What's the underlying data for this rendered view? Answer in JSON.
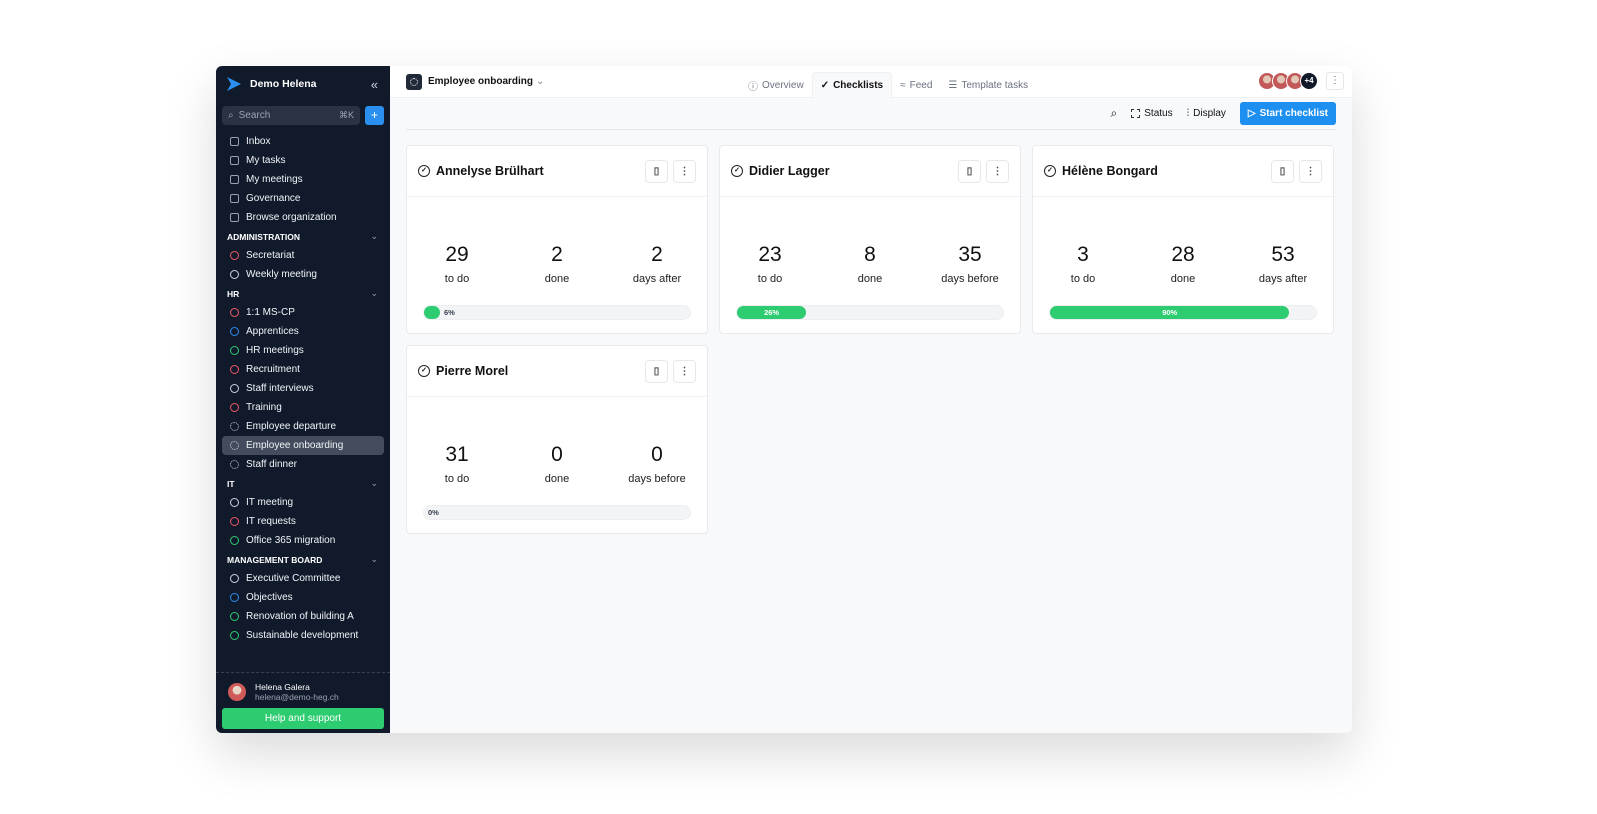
{
  "sidebar": {
    "org": "Demo Helena",
    "search_placeholder": "Search",
    "search_shortcut": "⌘K",
    "nav": [
      {
        "label": "Inbox",
        "icon": "inbox-icon"
      },
      {
        "label": "My tasks",
        "icon": "task-icon"
      },
      {
        "label": "My meetings",
        "icon": "calendar-icon"
      },
      {
        "label": "Governance",
        "icon": "governance-icon"
      },
      {
        "label": "Browse organization",
        "icon": "building-icon"
      }
    ],
    "sections": [
      {
        "title": "ADMINISTRATION",
        "items": [
          {
            "label": "Secretariat",
            "color": "#f05a67"
          },
          {
            "label": "Weekly meeting",
            "color": "#cbd5e1"
          }
        ]
      },
      {
        "title": "HR",
        "items": [
          {
            "label": "1:1 MS-CP",
            "color": "#f05a67"
          },
          {
            "label": "Apprentices",
            "color": "#2b8ff0"
          },
          {
            "label": "HR meetings",
            "color": "#2ecc71"
          },
          {
            "label": "Recruitment",
            "color": "#f05a67"
          },
          {
            "label": "Staff interviews",
            "color": "#cbd5e1"
          },
          {
            "label": "Training",
            "color": "#f05a67"
          },
          {
            "label": "Employee departure",
            "color": "dashed"
          },
          {
            "label": "Employee onboarding",
            "color": "dashed",
            "active": true
          },
          {
            "label": "Staff dinner",
            "color": "dashed"
          }
        ]
      },
      {
        "title": "IT",
        "items": [
          {
            "label": "IT meeting",
            "color": "#cbd5e1"
          },
          {
            "label": "IT requests",
            "color": "#f05a67"
          },
          {
            "label": "Office 365 migration",
            "color": "#2ecc71"
          }
        ]
      },
      {
        "title": "MANAGEMENT BOARD",
        "items": [
          {
            "label": "Executive Committee",
            "color": "#cbd5e1"
          },
          {
            "label": "Objectives",
            "color": "#2b8ff0"
          },
          {
            "label": "Renovation of building A",
            "color": "#2ecc71"
          },
          {
            "label": "Sustainable development",
            "color": "#2ecc71"
          }
        ]
      }
    ],
    "user": {
      "name": "Helena Galera",
      "email": "helena@demo-heg.ch"
    },
    "help": "Help and support"
  },
  "header": {
    "project": "Employee onboarding",
    "tabs": [
      {
        "label": "Overview",
        "icon": "ⓘ"
      },
      {
        "label": "Checklists",
        "icon": "✓",
        "active": true
      },
      {
        "label": "Feed",
        "icon": "≈"
      },
      {
        "label": "Template tasks",
        "icon": "☰"
      }
    ],
    "members_more": "+4"
  },
  "toolbar": {
    "status": "Status",
    "display": "Display",
    "start": "Start checklist"
  },
  "cards": [
    {
      "name": "Annelyse Brülhart",
      "todo": "29",
      "todo_label": "to do",
      "done": "2",
      "done_label": "done",
      "days": "2",
      "days_label": "days after",
      "progress": 6,
      "progress_label": "6%"
    },
    {
      "name": "Didier Lagger",
      "todo": "23",
      "todo_label": "to do",
      "done": "8",
      "done_label": "done",
      "days": "35",
      "days_label": "days before",
      "progress": 26,
      "progress_label": "26%"
    },
    {
      "name": "Hélène Bongard",
      "todo": "3",
      "todo_label": "to do",
      "done": "28",
      "done_label": "done",
      "days": "53",
      "days_label": "days after",
      "progress": 90,
      "progress_label": "90%"
    },
    {
      "name": "Pierre Morel",
      "todo": "31",
      "todo_label": "to do",
      "done": "0",
      "done_label": "done",
      "days": "0",
      "days_label": "days before",
      "progress": 0,
      "progress_label": "0%"
    }
  ]
}
